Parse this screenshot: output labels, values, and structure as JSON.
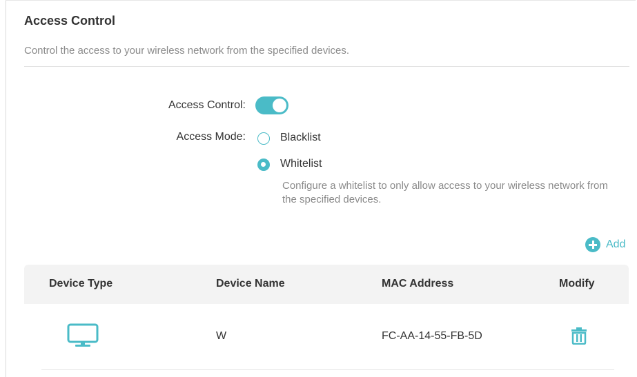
{
  "section": {
    "title": "Access Control",
    "description": "Control the access to your wireless network from the specified devices."
  },
  "settings": {
    "access_control_label": "Access Control:",
    "access_control_enabled": true,
    "access_mode_label": "Access Mode:",
    "modes": [
      {
        "label": "Blacklist",
        "selected": false
      },
      {
        "label": "Whitelist",
        "selected": true
      }
    ],
    "whitelist_hint": "Configure a whitelist to only allow access to your wireless network from the specified devices."
  },
  "actions": {
    "add_label": "Add",
    "add_icon": "plus-circle-icon"
  },
  "table": {
    "columns": [
      "Device Type",
      "Device Name",
      "MAC Address",
      "Modify"
    ],
    "rows": [
      {
        "device_type_icon": "monitor-icon",
        "device_name": "W",
        "mac_address": "FC-AA-14-55-FB-5D",
        "modify_icon": "trash-icon"
      }
    ]
  },
  "colors": {
    "accent": "#4abbc7",
    "header_bg": "#f3f3f3",
    "muted_text": "#8a8a8a"
  }
}
